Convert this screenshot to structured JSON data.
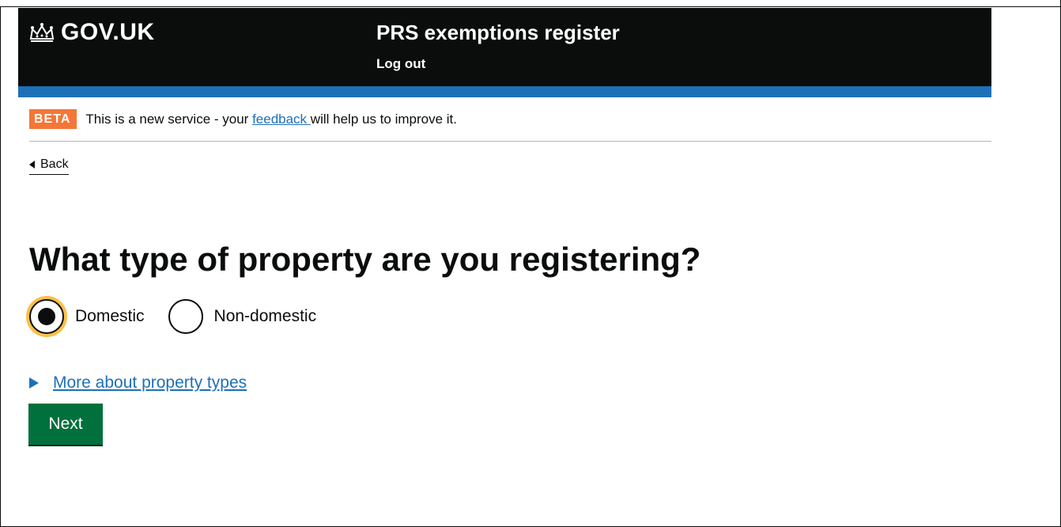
{
  "header": {
    "logo_text": "GOV.UK",
    "service_name": "PRS exemptions register",
    "logout_label": "Log out"
  },
  "beta_banner": {
    "tag": "BETA",
    "text_before": "This is a new service - your ",
    "link_text": "feedback ",
    "text_after": "will help us to improve it."
  },
  "back_link": "Back",
  "page_title": "What type of property are you registering?",
  "property_type": {
    "options": [
      {
        "label": "Domestic",
        "selected": true
      },
      {
        "label": "Non-domestic",
        "selected": false
      }
    ]
  },
  "details_summary": "More about property types",
  "next_button": "Next",
  "colors": {
    "header_bg": "#0b0c0c",
    "brand_blue": "#1d70b8",
    "beta_orange": "#f47738",
    "button_green": "#00703c",
    "focus_yellow": "#fcbf49"
  }
}
